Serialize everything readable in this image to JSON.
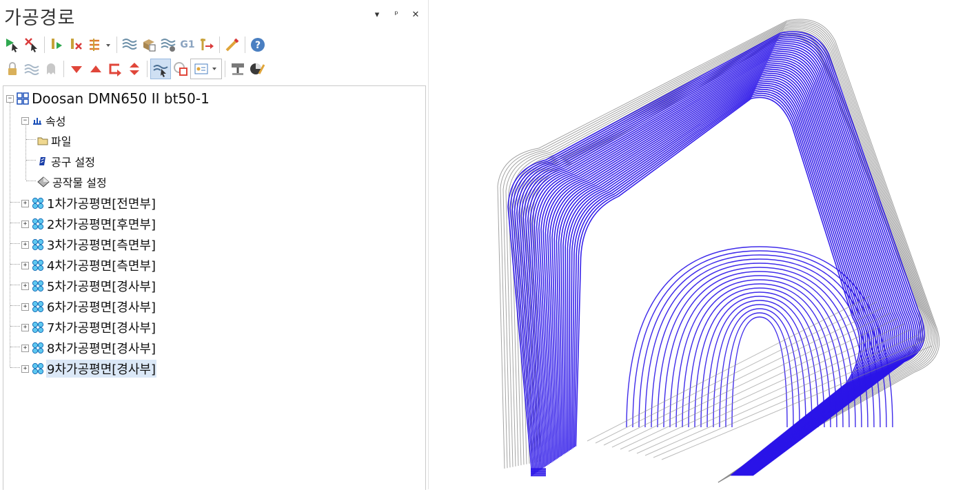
{
  "panel": {
    "title": "가공경로",
    "controls": {
      "dropdown": "▾",
      "pin": "ᵖ",
      "close": "✕"
    }
  },
  "toolbar_row1": [
    "select-play-icon",
    "deselect-icon",
    "tool-play-icon",
    "tool-delete-icon",
    "reorder-icon",
    "layers-icon",
    "stock-icon",
    "settings-layers-icon",
    "g1-icon",
    "tool-arrow-icon",
    "wand-icon",
    "help-icon"
  ],
  "toolbar_row2": [
    "lock-icon",
    "wave-icon",
    "ghost-icon",
    "move-down-icon",
    "move-up-icon",
    "loop-icon",
    "expand-collapse-icon",
    "path-select-icon",
    "path-copy-icon",
    "display-options-icon",
    "simulate-icon",
    "render-icon"
  ],
  "g1_text": "G1",
  "tree": {
    "root": {
      "label": "Doosan DMN650 II bt50-1",
      "expander": "−"
    },
    "properties": {
      "label": "속성",
      "expander": "−"
    },
    "property_items": [
      {
        "label": "파일",
        "icon": "folder-icon"
      },
      {
        "label": "공구 설정",
        "icon": "tool-icon"
      },
      {
        "label": "공작물 설정",
        "icon": "workpiece-icon"
      }
    ],
    "groups": [
      {
        "num": "1",
        "label": "차가공평면[전면부]",
        "expander": "+"
      },
      {
        "num": "2",
        "label": "차가공평면[후면부]",
        "expander": "+"
      },
      {
        "num": "3",
        "label": "차가공평면[측면부]",
        "expander": "+"
      },
      {
        "num": "4",
        "label": "차가공평면[측면부]",
        "expander": "+"
      },
      {
        "num": "5",
        "label": "차가공평면[경사부]",
        "expander": "+"
      },
      {
        "num": "6",
        "label": "차가공평면[경사부]",
        "expander": "+"
      },
      {
        "num": "7",
        "label": "차가공평면[경사부]",
        "expander": "+"
      },
      {
        "num": "8",
        "label": "차가공평면[경사부]",
        "expander": "+"
      },
      {
        "num": "9",
        "label": "차가공평면[경사부]",
        "expander": "+",
        "selected": true
      }
    ]
  },
  "colors": {
    "toolpath": "#2a14e8",
    "rapid": "#8c8c8c",
    "selection": "#dbe8f7"
  }
}
